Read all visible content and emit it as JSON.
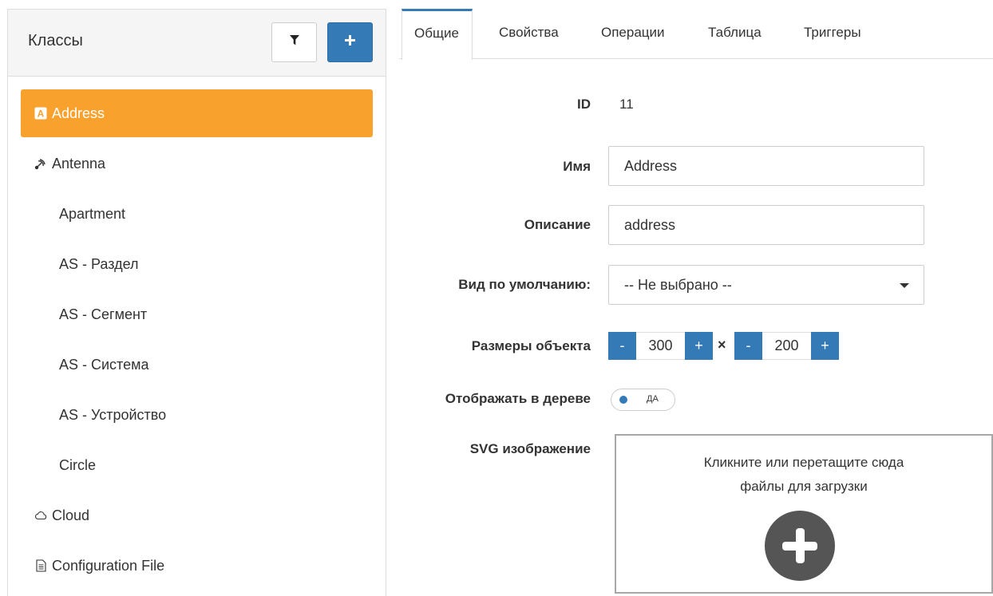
{
  "sidebar": {
    "title": "Классы",
    "filter_icon": "filter-icon",
    "add_icon": "plus-icon",
    "items": [
      {
        "label": "Address",
        "icon": "letter-a-icon",
        "active": true
      },
      {
        "label": "Antenna",
        "icon": "antenna-icon",
        "active": false
      },
      {
        "label": "Apartment",
        "icon": "",
        "active": false
      },
      {
        "label": "AS - Раздел",
        "icon": "",
        "active": false
      },
      {
        "label": "AS - Сегмент",
        "icon": "",
        "active": false
      },
      {
        "label": "AS - Система",
        "icon": "",
        "active": false
      },
      {
        "label": "AS - Устройство",
        "icon": "",
        "active": false
      },
      {
        "label": "Circle",
        "icon": "",
        "active": false
      },
      {
        "label": "Cloud",
        "icon": "cloud-icon",
        "active": false
      },
      {
        "label": "Configuration File",
        "icon": "file-icon",
        "active": false
      }
    ]
  },
  "tabs": [
    {
      "label": "Общие",
      "active": true
    },
    {
      "label": "Свойства",
      "active": false
    },
    {
      "label": "Операции",
      "active": false
    },
    {
      "label": "Таблица",
      "active": false
    },
    {
      "label": "Триггеры",
      "active": false
    }
  ],
  "form": {
    "id_label": "ID",
    "id_value": "11",
    "name_label": "Имя",
    "name_value": "Address",
    "desc_label": "Описание",
    "desc_value": "address",
    "view_label": "Вид по умолчанию:",
    "view_value": "-- Не выбрано --",
    "size_label": "Размеры объекта",
    "width_value": "300",
    "height_value": "200",
    "minus": "-",
    "plus": "+",
    "times": "×",
    "tree_label": "Отображать в дереве",
    "tree_toggle": "ДА",
    "svg_label": "SVG изображение",
    "dropzone_line1": "Кликните или перетащите сюда",
    "dropzone_line2": "файлы для загрузки"
  },
  "colors": {
    "accent": "#337ab7",
    "active_item": "#f8a22d"
  }
}
